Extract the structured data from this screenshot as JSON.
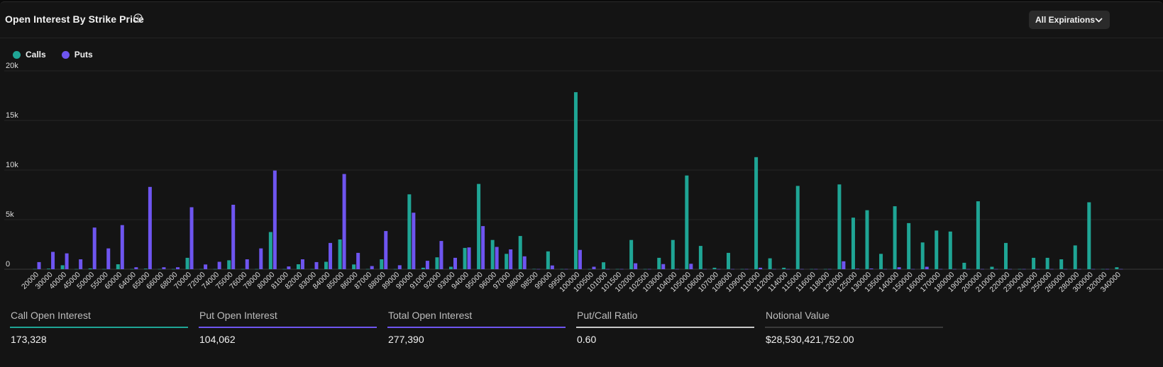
{
  "header": {
    "title": "Open Interest By Strike Price",
    "info_icon": "info-icon",
    "dropdown_label": "All Expirations",
    "dropdown_icon": "chevron-down-icon"
  },
  "legend": [
    {
      "label": "Calls",
      "color": "#1fa595"
    },
    {
      "label": "Puts",
      "color": "#6e55f0"
    }
  ],
  "chart_data": {
    "type": "bar",
    "title": "",
    "xlabel": "",
    "ylabel": "",
    "ylim": [
      0,
      20000
    ],
    "yticks": [
      0,
      5000,
      10000,
      15000,
      20000
    ],
    "ytick_labels": [
      "0",
      "5k",
      "10k",
      "15k",
      "20k"
    ],
    "grid": true,
    "legend_position": "top-left",
    "categories": [
      "20000",
      "30000",
      "40000",
      "45000",
      "50000",
      "55000",
      "60000",
      "64000",
      "65000",
      "66000",
      "68000",
      "70000",
      "72000",
      "74000",
      "75000",
      "76000",
      "78000",
      "80000",
      "81000",
      "82000",
      "83000",
      "84000",
      "85000",
      "86000",
      "87000",
      "88000",
      "89000",
      "90000",
      "91000",
      "92000",
      "93000",
      "94000",
      "95000",
      "96000",
      "97000",
      "98000",
      "98500",
      "99000",
      "99500",
      "100000",
      "100500",
      "101000",
      "101500",
      "102000",
      "102500",
      "103000",
      "104000",
      "105000",
      "106000",
      "107000",
      "108000",
      "109000",
      "110000",
      "112000",
      "114000",
      "115000",
      "116000",
      "118000",
      "120000",
      "125000",
      "130000",
      "135000",
      "140000",
      "150000",
      "160000",
      "170000",
      "180000",
      "190000",
      "200000",
      "210000",
      "220000",
      "230000",
      "240000",
      "250000",
      "260000",
      "280000",
      "300000",
      "320000",
      "340000"
    ],
    "series": [
      {
        "name": "Calls",
        "color": "#1fa595",
        "values": [
          30,
          60,
          400,
          20,
          80,
          20,
          500,
          20,
          60,
          20,
          20,
          1150,
          20,
          20,
          900,
          20,
          20,
          3750,
          20,
          500,
          20,
          750,
          3000,
          480,
          20,
          1000,
          20,
          7550,
          150,
          1200,
          250,
          2150,
          8600,
          2950,
          1550,
          3350,
          30,
          1800,
          20,
          17850,
          20,
          700,
          20,
          2950,
          20,
          1150,
          2950,
          9450,
          2350,
          150,
          1650,
          20,
          11300,
          1100,
          150,
          8400,
          20,
          20,
          8550,
          5200,
          5950,
          1550,
          6350,
          4650,
          2700,
          3900,
          3800,
          650,
          6850,
          250,
          2650,
          20,
          1150,
          1150,
          1000,
          2400,
          6750,
          20,
          200
        ]
      },
      {
        "name": "Puts",
        "color": "#6e55f0",
        "values": [
          720,
          1750,
          1600,
          1000,
          4200,
          2100,
          4450,
          200,
          8300,
          200,
          200,
          6250,
          480,
          750,
          6500,
          1000,
          2100,
          9950,
          280,
          1000,
          720,
          2650,
          9600,
          1650,
          320,
          3850,
          400,
          5700,
          850,
          2850,
          1150,
          2200,
          4350,
          2250,
          2000,
          1300,
          20,
          380,
          20,
          1950,
          250,
          20,
          20,
          600,
          20,
          520,
          20,
          550,
          20,
          20,
          20,
          20,
          150,
          20,
          20,
          20,
          20,
          20,
          800,
          50,
          70,
          20,
          200,
          20,
          250,
          20,
          20,
          20,
          20,
          20,
          20,
          20,
          20,
          20,
          20,
          20,
          20,
          20,
          20
        ]
      }
    ]
  },
  "stats": [
    {
      "label": "Call Open Interest",
      "value": "173,328",
      "color": "#1fa595"
    },
    {
      "label": "Put Open Interest",
      "value": "104,062",
      "color": "#6e55f0"
    },
    {
      "label": "Total Open Interest",
      "value": "277,390",
      "color": "#6e55f0"
    },
    {
      "label": "Put/Call Ratio",
      "value": "0.60",
      "color": "#c8c8c8"
    },
    {
      "label": "Notional Value",
      "value": "$28,530,421,752.00",
      "color": "#3a3a3a"
    }
  ]
}
